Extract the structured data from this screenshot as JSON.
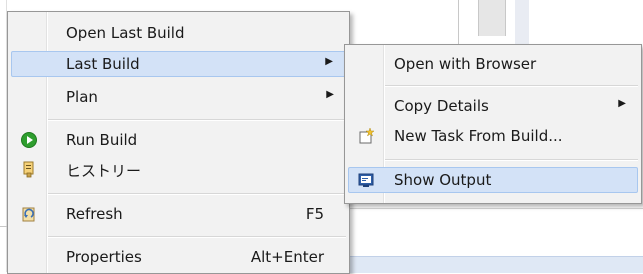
{
  "menu": {
    "items": [
      {
        "label": "Open Last Build",
        "shortcut": "",
        "submenu": false,
        "icon": ""
      },
      {
        "label": "Last Build",
        "shortcut": "",
        "submenu": true,
        "icon": ""
      },
      {
        "label": "Plan",
        "shortcut": "",
        "submenu": true,
        "icon": ""
      },
      {
        "label": "Run Build",
        "shortcut": "",
        "submenu": false,
        "icon": "play-icon"
      },
      {
        "label": "ヒストリー",
        "shortcut": "",
        "submenu": false,
        "icon": "history-icon"
      },
      {
        "label": "Refresh",
        "shortcut": "F5",
        "submenu": false,
        "icon": "refresh-icon"
      },
      {
        "label": "Properties",
        "shortcut": "Alt+Enter",
        "submenu": false,
        "icon": ""
      }
    ],
    "submenu_arrow": "▶"
  },
  "submenu": {
    "items": [
      {
        "label": "Open with Browser",
        "submenu": false,
        "icon": ""
      },
      {
        "label": "Copy Details",
        "submenu": true,
        "icon": ""
      },
      {
        "label": "New Task From Build...",
        "submenu": false,
        "icon": "new-task-icon"
      },
      {
        "label": "Show Output",
        "submenu": false,
        "icon": "console-icon"
      }
    ]
  },
  "colors": {
    "menu_bg": "#f2f2f2",
    "highlight_bg": "#d3e2f7",
    "highlight_border": "#a8c7ef",
    "run_icon_green": "#2e9e2e"
  }
}
